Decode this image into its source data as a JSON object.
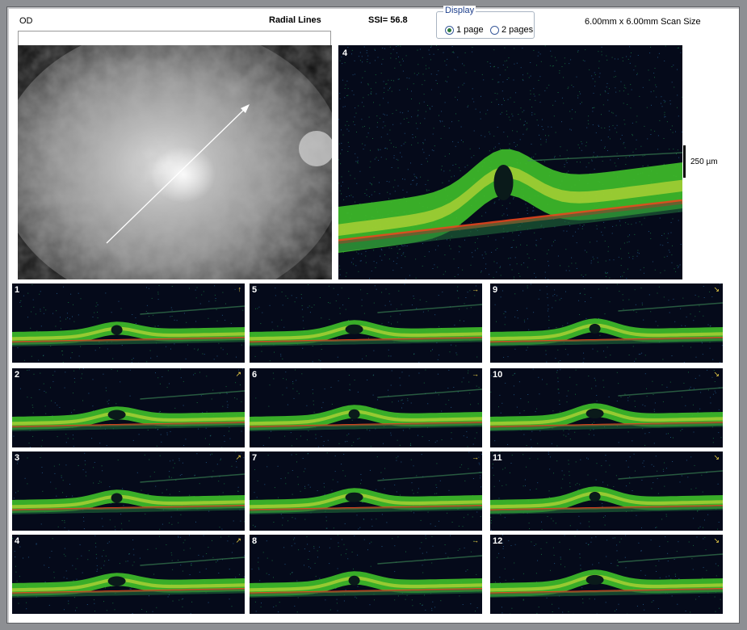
{
  "header": {
    "eye": "OD",
    "scan_type": "Radial Lines",
    "ssi": "SSI= 56.8",
    "scan_size": "6.00mm x 6.00mm Scan Size"
  },
  "display": {
    "legend": "Display",
    "options": [
      {
        "label": "1 page",
        "selected": true
      },
      {
        "label": "2 pages",
        "selected": false
      }
    ]
  },
  "main_scan": {
    "label": "4",
    "scale_label": "250 µm"
  },
  "thumbnails": [
    {
      "label": "1"
    },
    {
      "label": "5"
    },
    {
      "label": "9"
    },
    {
      "label": "2"
    },
    {
      "label": "6"
    },
    {
      "label": "10"
    },
    {
      "label": "3"
    },
    {
      "label": "7"
    },
    {
      "label": "11"
    },
    {
      "label": "4"
    },
    {
      "label": "8"
    },
    {
      "label": "12"
    }
  ],
  "colors": {
    "retina_green": "#3fbf2a",
    "retina_yellow": "#e6e23a",
    "rpe_red": "#e8461e",
    "background_dark": "#050a1a"
  }
}
